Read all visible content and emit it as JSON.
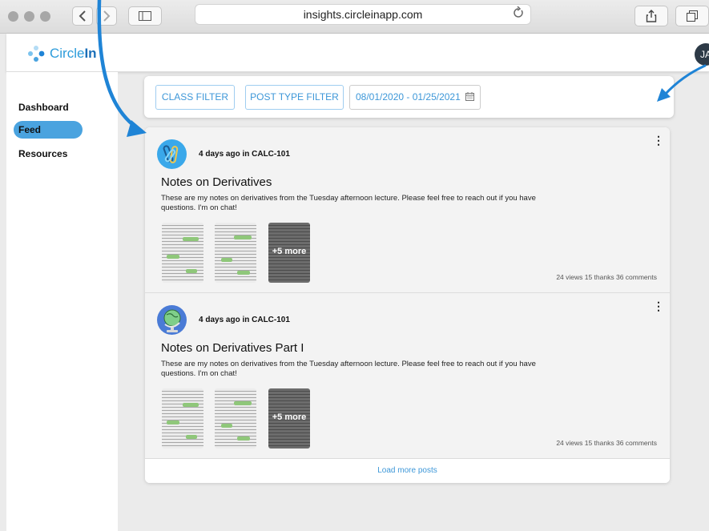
{
  "browser": {
    "url": "insights.circleinapp.com"
  },
  "app": {
    "logo_text": "CircleIn",
    "logo_prefix": "Circle",
    "logo_suffix": "In",
    "avatar_initials": "JA"
  },
  "sidebar": {
    "items": [
      {
        "label": "Dashboard",
        "active": false
      },
      {
        "label": "Feed",
        "active": true
      },
      {
        "label": "Resources",
        "active": false
      }
    ]
  },
  "filters": {
    "class_filter": "CLASS FILTER",
    "post_type_filter": "POST TYPE FILTER",
    "date_range": "08/01/2020 - 01/25/2021"
  },
  "posts": [
    {
      "meta": "4 days ago in CALC-101",
      "title": "Notes on Derivatives",
      "body": "These are my notes on derivatives from the Tuesday afternoon lecture. Please feel free to reach out if you have questions. I'm on chat!",
      "more_label": "+5 more",
      "stats": "24 views 15 thanks 36 comments",
      "avatar_icon": "clips-icon"
    },
    {
      "meta": "4 days ago in CALC-101",
      "title": "Notes on Derivatives Part I",
      "body": "These are my notes on derivatives from the Tuesday afternoon lecture. Please feel free to reach out if you have questions. I'm on chat!",
      "more_label": "+5 more",
      "stats": "24 views 15 thanks 36 comments",
      "avatar_icon": "globe-icon"
    }
  ],
  "feed": {
    "load_more": "Load more posts"
  },
  "colors": {
    "accent": "#3d97d8",
    "active_nav": "#4aa3df",
    "annotation_arrow": "#1f84d6"
  }
}
